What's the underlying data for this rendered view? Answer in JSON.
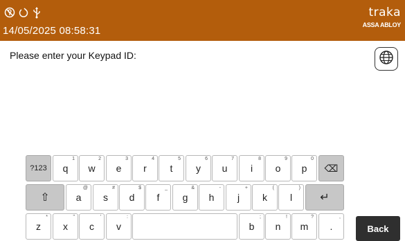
{
  "header": {
    "datetime": "14/05/2025 08:58:31",
    "logo_word": "traka",
    "logo_sub": "ASSA ABLOY",
    "status_icons": [
      "no-key-icon",
      "power-icon",
      "usb-icon"
    ]
  },
  "prompt": "Please enter your Keypad ID:",
  "lang_icon": "globe-icon",
  "keyboard": {
    "row1": [
      {
        "label": "?123",
        "hint": ""
      },
      {
        "label": "q",
        "hint": "1"
      },
      {
        "label": "w",
        "hint": "2"
      },
      {
        "label": "e",
        "hint": "3"
      },
      {
        "label": "r",
        "hint": "4"
      },
      {
        "label": "t",
        "hint": "5"
      },
      {
        "label": "y",
        "hint": "6"
      },
      {
        "label": "u",
        "hint": "7"
      },
      {
        "label": "i",
        "hint": "8"
      },
      {
        "label": "o",
        "hint": "9"
      },
      {
        "label": "p",
        "hint": "0"
      },
      {
        "label": "⌫",
        "hint": ""
      }
    ],
    "row2": [
      {
        "label": "⇧",
        "hint": ""
      },
      {
        "label": "a",
        "hint": "@"
      },
      {
        "label": "s",
        "hint": "#"
      },
      {
        "label": "d",
        "hint": "$"
      },
      {
        "label": "f",
        "hint": "_"
      },
      {
        "label": "g",
        "hint": "&"
      },
      {
        "label": "h",
        "hint": "-"
      },
      {
        "label": "j",
        "hint": "+"
      },
      {
        "label": "k",
        "hint": "("
      },
      {
        "label": "l",
        "hint": ")"
      },
      {
        "label": "↵",
        "hint": ""
      }
    ],
    "row3": [
      {
        "label": "z",
        "hint": "*"
      },
      {
        "label": "x",
        "hint": "\""
      },
      {
        "label": "c",
        "hint": "'"
      },
      {
        "label": "v",
        "hint": ":"
      },
      {
        "label": "",
        "hint": ""
      },
      {
        "label": "b",
        "hint": ";"
      },
      {
        "label": "n",
        "hint": "!"
      },
      {
        "label": "m",
        "hint": "?"
      },
      {
        "label": ".",
        "hint": ","
      }
    ]
  },
  "back_label": "Back"
}
